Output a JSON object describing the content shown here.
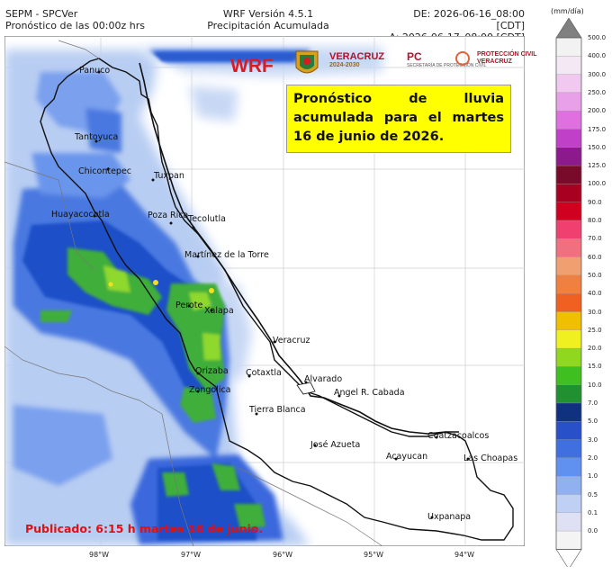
{
  "header": {
    "left_line1": "SEPM - SPCVer",
    "left_line2": "Pronóstico de las 00:00z hrs",
    "center_line1": "WRF Versión 4.5.1",
    "center_line2": "Precipitación Acumulada",
    "right_line1": "DE: 2026-06-16_08:00 [CDT]",
    "right_line2": "A: 2026-06-17_08:00 [CDT]"
  },
  "logos": {
    "wrf": "WRF",
    "veracruz": "VERACRUZ",
    "veracruz_sub": "2024-2030",
    "pc": "PC",
    "pc_sub": "SECRETARÍA DE PROTECCIÓN CIVIL",
    "pcv_line1": "PROTECCIÓN CIVIL",
    "pcv_line2": "VERACRUZ"
  },
  "callout": {
    "text": "Pronóstico de lluvia acumulada para el martes 16 de junio de 2026."
  },
  "published": "Publicado: 6:15 h martes 16 de junio.",
  "cities": [
    {
      "name": "Panuco"
    },
    {
      "name": "Tantoyuca"
    },
    {
      "name": "Chicontepec"
    },
    {
      "name": "Tuxpan"
    },
    {
      "name": "Huayacocotla"
    },
    {
      "name": "Poza Rica"
    },
    {
      "name": "Tecolutla"
    },
    {
      "name": "Martínez de la Torre"
    },
    {
      "name": "Perote"
    },
    {
      "name": "Xalapa"
    },
    {
      "name": "Veracruz"
    },
    {
      "name": "Cotaxtla"
    },
    {
      "name": "Alvarado"
    },
    {
      "name": "Orizaba"
    },
    {
      "name": "Zongolica"
    },
    {
      "name": "Tierra Blanca"
    },
    {
      "name": "Angel R. Cabada"
    },
    {
      "name": "José Azueta"
    },
    {
      "name": "Acayucan"
    },
    {
      "name": "Coatzacoalcos"
    },
    {
      "name": "Las Choapas"
    },
    {
      "name": "Uxpanapa"
    }
  ],
  "longitude_ticks": [
    "98°W",
    "97°W",
    "96°W",
    "95°W",
    "94°W"
  ],
  "colorbar": {
    "unit": "(mm/día)",
    "levels": [
      "500.0",
      "400.0",
      "300.0",
      "250.0",
      "200.0",
      "175.0",
      "150.0",
      "125.0",
      "100.0",
      "90.0",
      "80.0",
      "70.0",
      "60.0",
      "50.0",
      "40.0",
      "30.0",
      "25.0",
      "20.0",
      "15.0",
      "10.0",
      "7.0",
      "5.0",
      "3.0",
      "2.0",
      "1.0",
      "0.5",
      "0.1",
      "0.0"
    ],
    "colors": [
      "#f2f2f2",
      "#f5e8f5",
      "#f0c8f0",
      "#e8a0e8",
      "#e070e0",
      "#c040c8",
      "#8c1a8c",
      "#7a0a2a",
      "#a80020",
      "#d00020",
      "#f04070",
      "#f07080",
      "#f0a070",
      "#f08040",
      "#f06020",
      "#f0c000",
      "#f0f020",
      "#90d820",
      "#40c020",
      "#209030",
      "#103080",
      "#2850c8",
      "#4070e0",
      "#6090f0",
      "#90b0f0",
      "#c0d0f4",
      "#e0e0f4",
      "#f4f4f4"
    ],
    "low_colors": [
      "#f8f8f8",
      "#e8e8f4"
    ]
  }
}
